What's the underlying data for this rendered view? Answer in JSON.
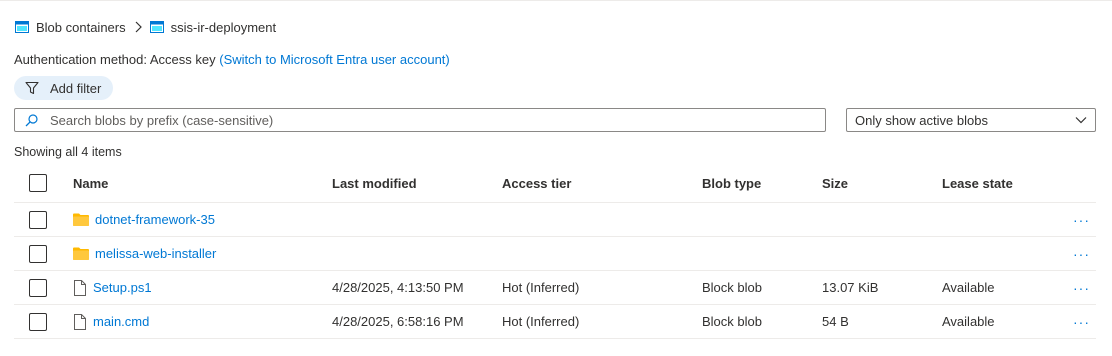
{
  "breadcrumb": {
    "items": [
      "Blob containers",
      "ssis-ir-deployment"
    ]
  },
  "auth": {
    "label": "Authentication method:",
    "value": "Access key",
    "switch_link": "(Switch to Microsoft Entra user account)"
  },
  "filter": {
    "add_filter_label": "Add filter"
  },
  "search": {
    "placeholder": "Search blobs by prefix (case-sensitive)",
    "value": ""
  },
  "dropdown": {
    "selected": "Only show active blobs"
  },
  "summary": "Showing all 4 items",
  "table": {
    "columns": [
      "Name",
      "Last modified",
      "Access tier",
      "Blob type",
      "Size",
      "Lease state"
    ],
    "rows": [
      {
        "kind": "folder",
        "name": "dotnet-framework-35",
        "modified": "",
        "tier": "",
        "type": "",
        "size": "",
        "lease": ""
      },
      {
        "kind": "folder",
        "name": "melissa-web-installer",
        "modified": "",
        "tier": "",
        "type": "",
        "size": "",
        "lease": ""
      },
      {
        "kind": "file",
        "name": "Setup.ps1",
        "modified": "4/28/2025, 4:13:50 PM",
        "tier": "Hot (Inferred)",
        "type": "Block blob",
        "size": "13.07 KiB",
        "lease": "Available"
      },
      {
        "kind": "file",
        "name": "main.cmd",
        "modified": "4/28/2025, 6:58:16 PM",
        "tier": "Hot (Inferred)",
        "type": "Block blob",
        "size": "54 B",
        "lease": "Available"
      }
    ],
    "more_glyph": "···"
  },
  "icons": {
    "container": "container-icon",
    "chevron": "chevron-right-icon",
    "filter": "filter-icon",
    "search": "search-icon",
    "dropdown": "chevron-down-icon",
    "folder": "folder-icon",
    "file": "file-icon"
  },
  "colors": {
    "link": "#0078d4",
    "folder": "#ffb900",
    "pill": "#e5f0fa",
    "container": "#0078d4"
  }
}
